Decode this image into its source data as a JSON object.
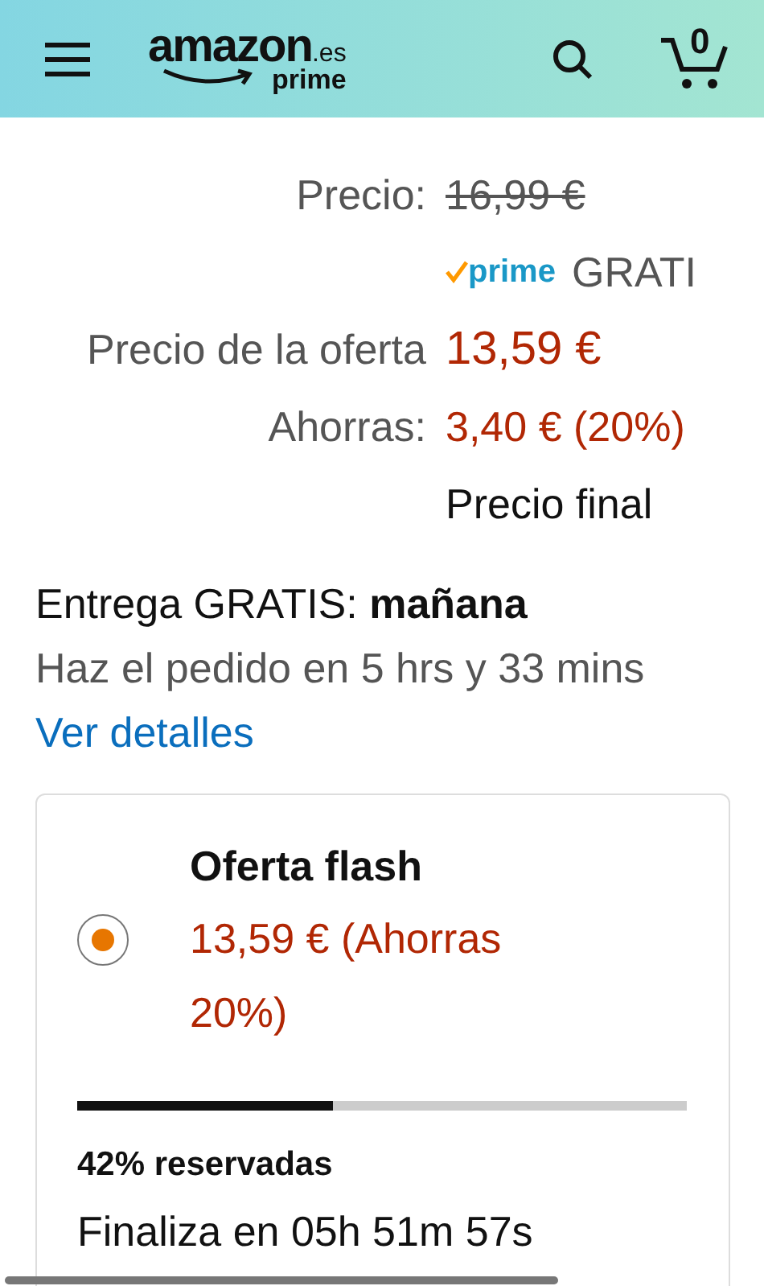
{
  "header": {
    "logo": {
      "brand": "amazon",
      "domain": ".es",
      "program": "prime"
    },
    "cart_count": "0"
  },
  "prices": [
    {
      "kind": "strike",
      "label": "Precio:",
      "value": "16,99 €"
    },
    {
      "kind": "prime",
      "value": "GRATI"
    },
    {
      "kind": "deal",
      "label": "Precio de la oferta",
      "value": "13,59 €"
    },
    {
      "kind": "savings",
      "label": "Ahorras:",
      "value": "3,40 € (20%)"
    },
    {
      "kind": "note",
      "value": "Precio final"
    }
  ],
  "prime_badge": "prime",
  "delivery": {
    "line": "Entrega GRATIS: **mañana**",
    "detail": "Haz el pedido en 5 hrs y 33 mins",
    "link": "Ver detalles"
  },
  "offer": {
    "selected": true,
    "title": "Oferta flash",
    "price": "13,59 € (Ahorras 20%)",
    "level": 0.42,
    "claimed": "42% reservadas",
    "ends": "Finaliza en 05h 51m 57s"
  }
}
